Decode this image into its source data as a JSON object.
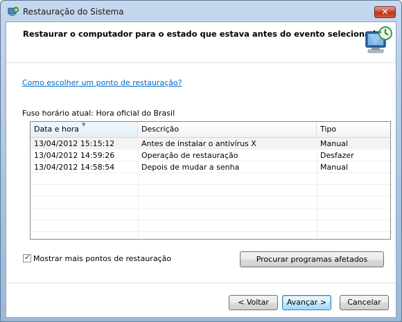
{
  "window": {
    "title": "Restauração do Sistema",
    "close_label": "✕"
  },
  "header": {
    "text": "Restaurar o computador para o estado que estava antes do evento selecionado"
  },
  "help_link": "Como escolher um ponto de restauração?",
  "timezone_label": "Fuso horário atual: Hora oficial do Brasil",
  "table": {
    "columns": [
      "Data e hora",
      "Descrição",
      "Tipo"
    ],
    "rows": [
      {
        "date": "13/04/2012 15:15:12",
        "description": "Antes de instalar o antivírus X",
        "type": "Manual"
      },
      {
        "date": "13/04/2012 14:59:26",
        "description": "Operação de restauração",
        "type": "Desfazer"
      },
      {
        "date": "13/04/2012 14:58:54",
        "description": "Depois de mudar a senha",
        "type": "Manual"
      }
    ]
  },
  "show_more": {
    "label": "Mostrar mais pontos de restauração",
    "checked": true
  },
  "buttons": {
    "scan": "Procurar programas afetados",
    "back": "< Voltar",
    "next": "Avançar >",
    "cancel": "Cancelar"
  },
  "icons": {
    "title": "system-restore-icon",
    "header": "computer-restore-icon"
  },
  "colors": {
    "link": "#0066cc",
    "close_button": "#c9452c",
    "default_button_border": "#3c7fb1"
  }
}
